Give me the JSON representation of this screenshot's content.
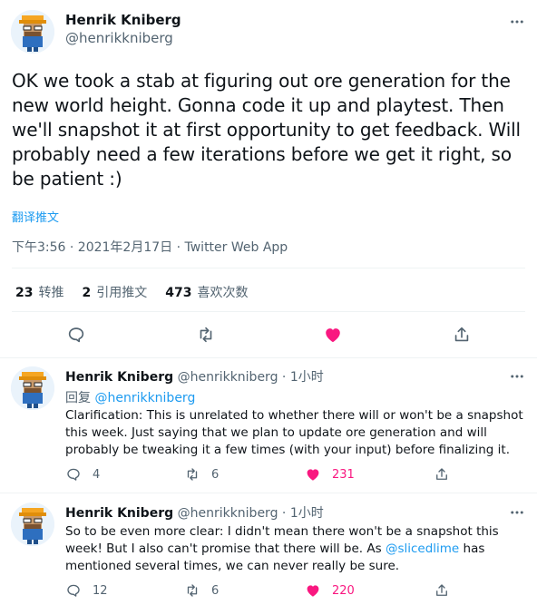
{
  "main_tweet": {
    "author_name": "Henrik Kniberg",
    "author_handle": "@henrikkniberg",
    "text": "OK we took a stab at figuring out ore generation for the new world height. Gonna code it up and playtest. Then we'll snapshot it at first opportunity to get feedback. Will probably need a few iterations before we get it right, so be patient :)",
    "translate_label": "翻译推文",
    "timestamp": "下午3:56 · 2021年2月17日 · Twitter Web App",
    "stats": {
      "retweets_count": "23",
      "retweets_label": "转推",
      "quotes_count": "2",
      "quotes_label": "引用推文",
      "likes_count": "473",
      "likes_label": "喜欢次数"
    },
    "actions": [
      "reply-icon",
      "retweet-icon",
      "like-icon-filled",
      "share-icon"
    ]
  },
  "replies": [
    {
      "author_name": "Henrik Kniberg",
      "author_handle": "@henrikkniberg",
      "separator": "·",
      "time": "1小时",
      "reply_prefix": "回复",
      "reply_to": "@henrikkniberg",
      "text": "Clarification: This is unrelated to whether there will or won't be a snapshot this week. Just saying that we plan to update ore generation and will probably be tweaking it a few times (with your input) before finalizing it.",
      "reply_count": "4",
      "retweet_count": "6",
      "like_count": "231"
    },
    {
      "author_name": "Henrik Kniberg",
      "author_handle": "@henrikkniberg",
      "separator": "·",
      "time": "1小时",
      "text_before_mention": "So to be even more clear: I didn't mean there won't be a snapshot this week! But I also can't promise that there will be. As ",
      "mention": "@slicedlime",
      "text_after_mention": " has mentioned several times, we can never really be sure.",
      "reply_count": "12",
      "retweet_count": "6",
      "like_count": "220"
    }
  ],
  "colors": {
    "accent": "#1d9bf0",
    "like": "#f91880",
    "muted_text": "#536471",
    "divider": "#eff3f4"
  }
}
